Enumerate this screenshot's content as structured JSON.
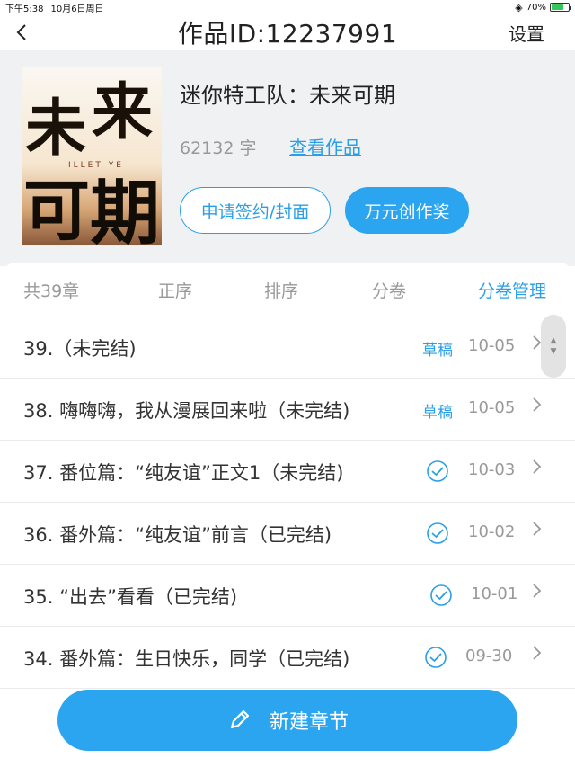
{
  "status_bar": {
    "time": "下午5:38",
    "date": "10月6日周日",
    "battery": "70%",
    "battery_level": 0.7
  },
  "nav": {
    "title": "作品ID:12237991",
    "settings_label": "设置",
    "back_icon": "chevron-left-icon"
  },
  "book": {
    "cover_chars": [
      "未",
      "来",
      "可",
      "期"
    ],
    "cover_subtitle": "ILLET YE",
    "title": "迷你特工队：未来可期",
    "word_count": "62132 字",
    "view_label": "查看作品",
    "sign_button": "申请签约/封面",
    "award_button": "万元创作奖"
  },
  "toolbar": {
    "total": "共39章",
    "order": "正序",
    "sort": "排序",
    "volume": "分卷",
    "manage": "分卷管理"
  },
  "chapters": [
    {
      "title": "39.（未完结)",
      "status": "草稿",
      "published": false,
      "date": "10-05"
    },
    {
      "title": "38. 嗨嗨嗨，我从漫展回来啦（未完结)",
      "status": "草稿",
      "published": false,
      "date": "10-05"
    },
    {
      "title": "37. 番位篇：“纯友谊”正文1（未完结)",
      "status": "",
      "published": true,
      "date": "10-03"
    },
    {
      "title": "36. 番外篇：“纯友谊”前言（已完结)",
      "status": "",
      "published": true,
      "date": "10-02"
    },
    {
      "title": "35. “出去”看看（已完结)",
      "status": "",
      "published": true,
      "date": "10-01"
    },
    {
      "title": "34. 番外篇：生日快乐，同学（已完结)",
      "status": "",
      "published": true,
      "date": "09-30"
    }
  ],
  "new_chapter_button": "新建章节",
  "colors": {
    "accent": "#2ba5ef",
    "link": "#2a9fe6",
    "header_bg": "#eff1f3"
  }
}
